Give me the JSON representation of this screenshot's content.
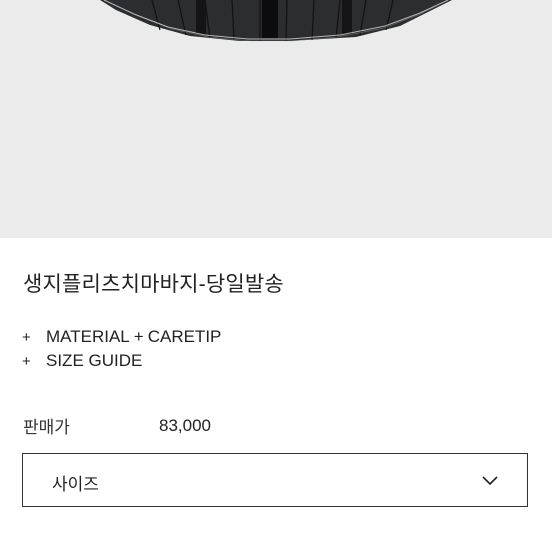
{
  "product": {
    "title": "생지플리츠치마바지-당일발송"
  },
  "info_links": {
    "plus_symbol": "+",
    "material_label": "MATERIAL",
    "caretip_label": "CARETIP",
    "size_guide_label": "SIZE GUIDE"
  },
  "price": {
    "label": "판매가",
    "value": "83,000"
  },
  "size_select": {
    "selected": "사이즈",
    "icon": "chevron-down-icon"
  },
  "colors": {
    "hero_background": "#ebebeb",
    "skirt": "#2c2d30",
    "stitch": "#d8d8d8",
    "border": "#333333"
  }
}
